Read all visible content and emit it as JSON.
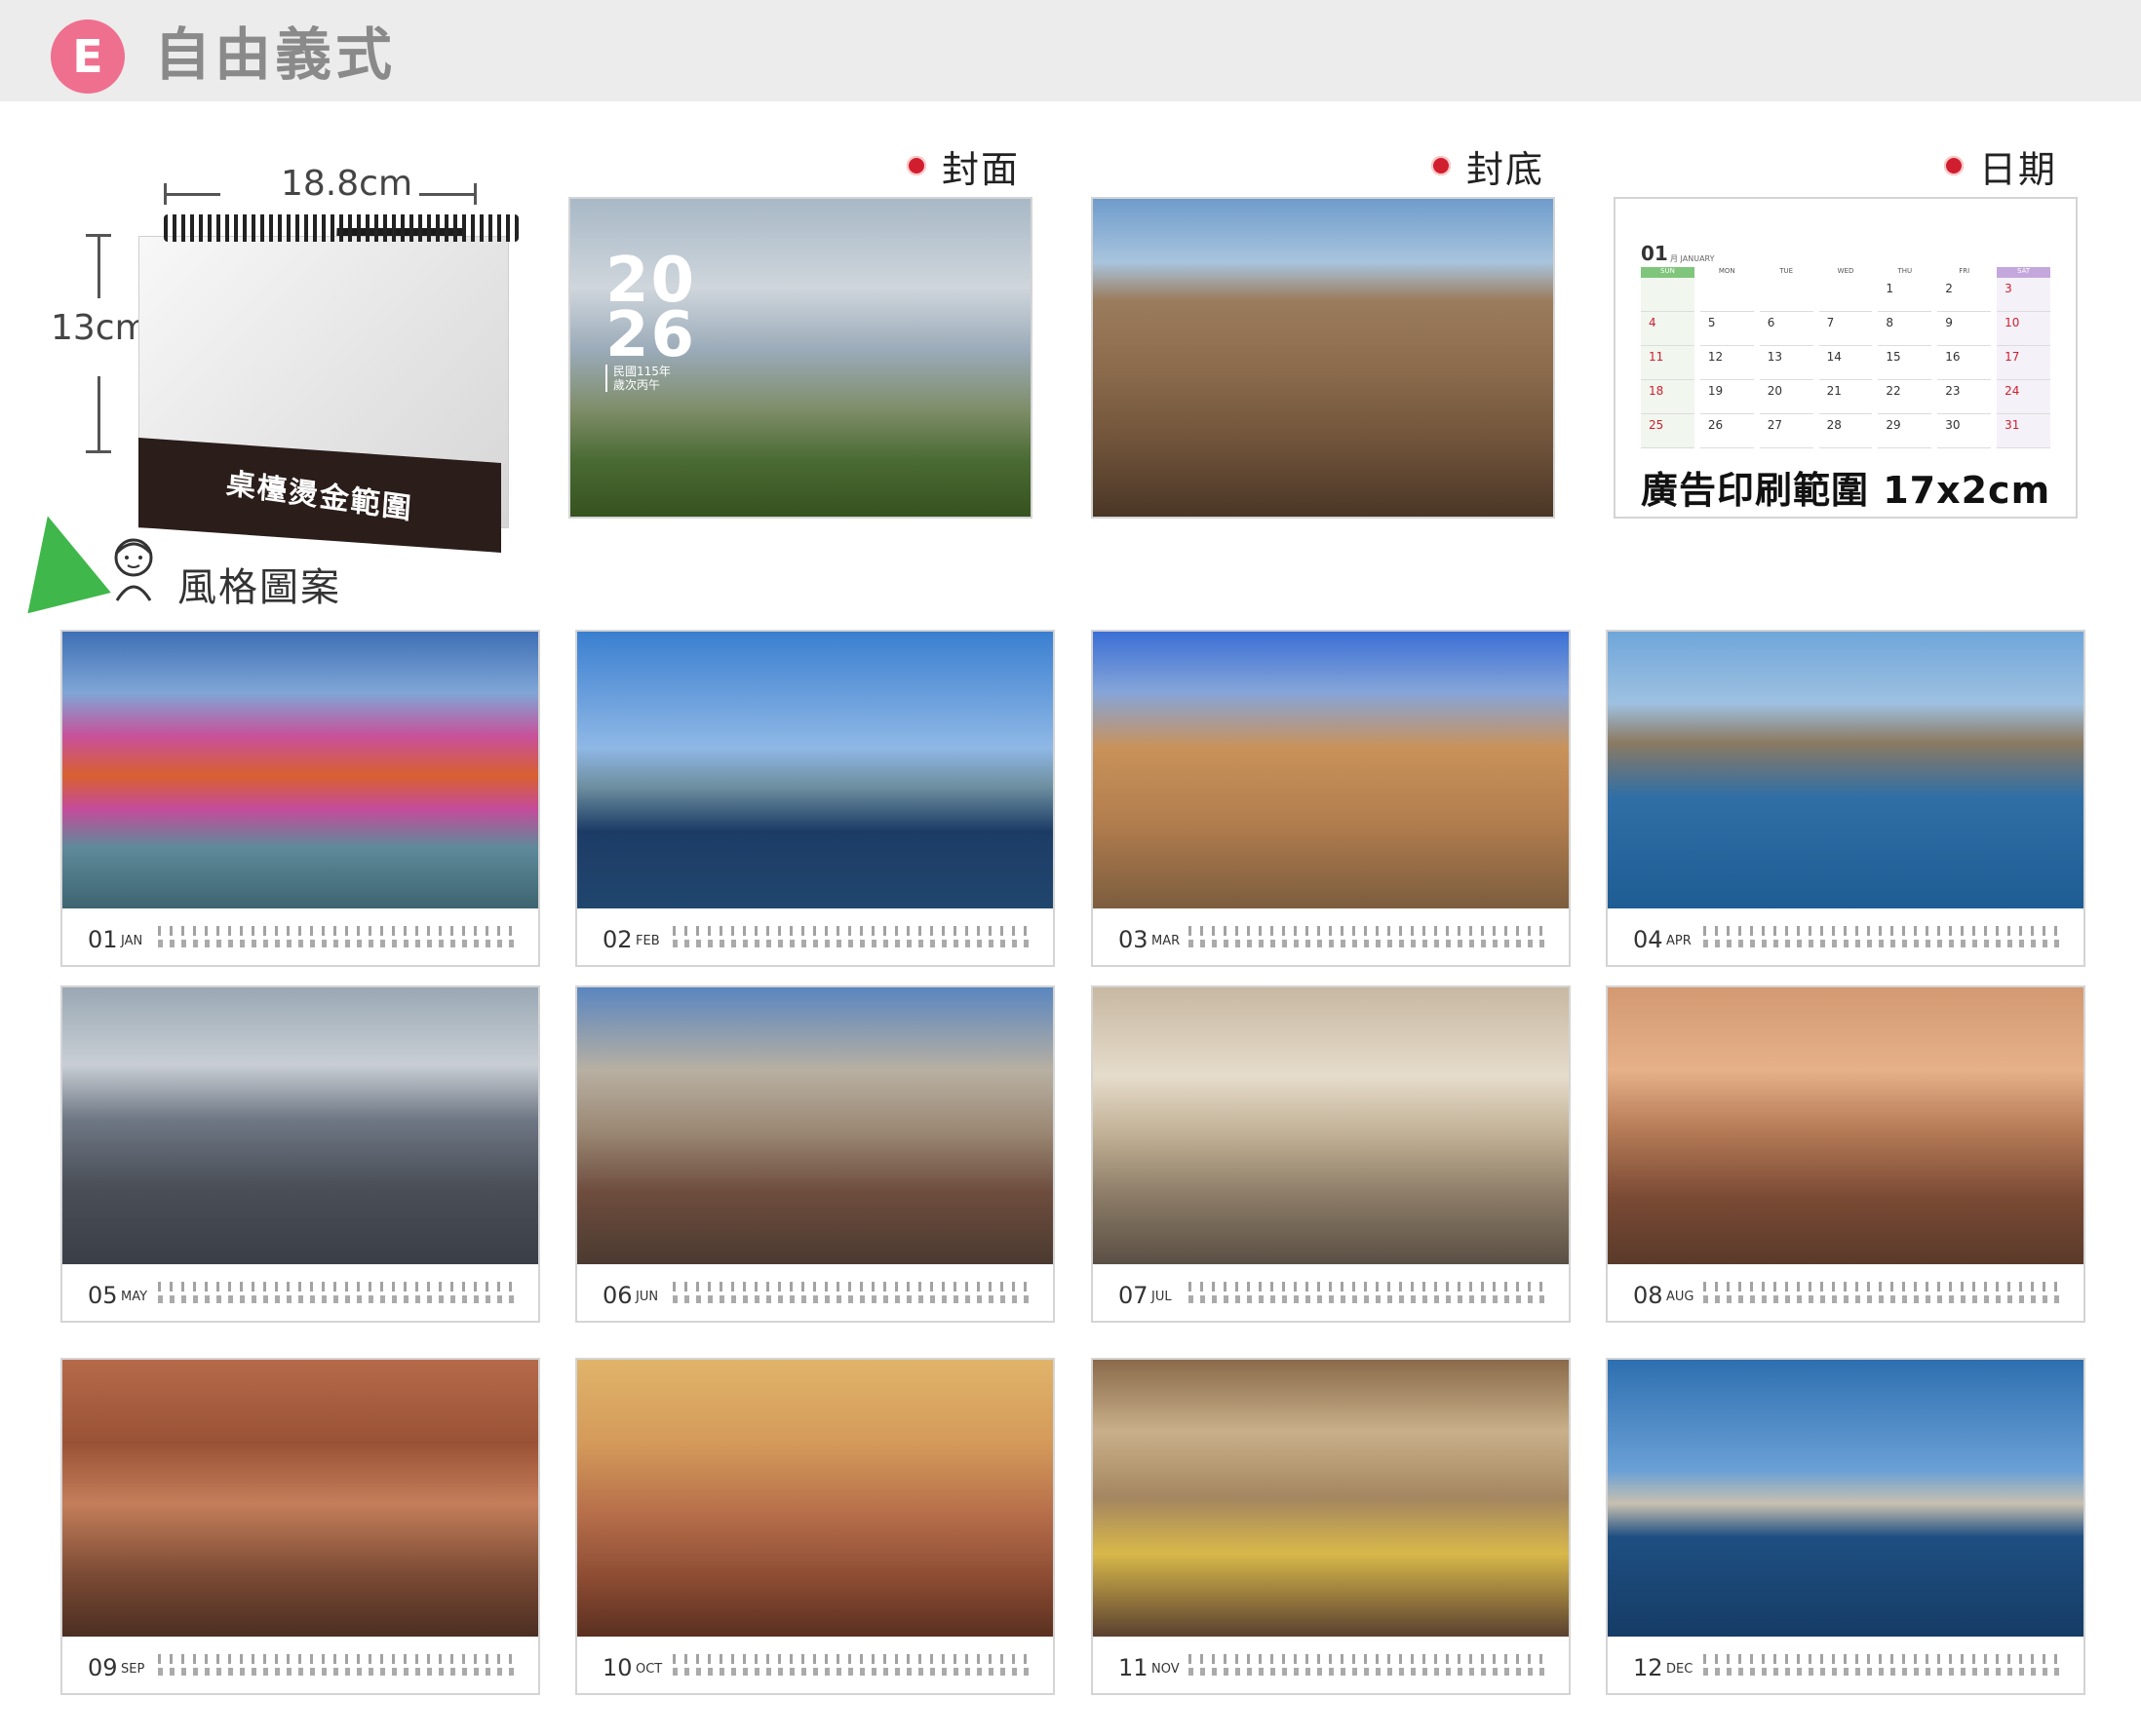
{
  "header": {
    "badge_letter": "E",
    "title": "自由義式"
  },
  "illustration": {
    "width_label": "18.8cm",
    "height_label": "13cm",
    "base_label": "桌檯燙金範圍"
  },
  "style_label": "風格圖案",
  "sections": {
    "cover": "封面",
    "back": "封底",
    "date": "日期"
  },
  "cover": {
    "year_top": "20",
    "year_bottom": "26",
    "sub1": "民國115年",
    "sub2": "歲次丙午"
  },
  "date_panel": {
    "month": "01",
    "month_sub": "月 JANUARY",
    "weekdays": [
      "SUN",
      "MON",
      "TUE",
      "WED",
      "THU",
      "FRI",
      "SAT"
    ],
    "weeks": [
      [
        "",
        "",
        "",
        "",
        "1",
        "2",
        "3"
      ],
      [
        "4",
        "5",
        "6",
        "7",
        "8",
        "9",
        "10"
      ],
      [
        "11",
        "12",
        "13",
        "14",
        "15",
        "16",
        "17"
      ],
      [
        "18",
        "19",
        "20",
        "21",
        "22",
        "23",
        "24"
      ],
      [
        "25",
        "26",
        "27",
        "28",
        "29",
        "30",
        "31"
      ]
    ],
    "ad_text": "廣告印刷範圍 17x2cm"
  },
  "months": [
    {
      "num": "01",
      "abbr": "JAN"
    },
    {
      "num": "02",
      "abbr": "FEB"
    },
    {
      "num": "03",
      "abbr": "MAR"
    },
    {
      "num": "04",
      "abbr": "APR"
    },
    {
      "num": "05",
      "abbr": "MAY"
    },
    {
      "num": "06",
      "abbr": "JUN"
    },
    {
      "num": "07",
      "abbr": "JUL"
    },
    {
      "num": "08",
      "abbr": "AUG"
    },
    {
      "num": "09",
      "abbr": "SEP"
    },
    {
      "num": "10",
      "abbr": "OCT"
    },
    {
      "num": "11",
      "abbr": "NOV"
    },
    {
      "num": "12",
      "abbr": "DEC"
    }
  ],
  "colors": {
    "badge": "#ef6f8f",
    "accent_red": "#d11e2e",
    "triangle": "#3fb74a"
  }
}
